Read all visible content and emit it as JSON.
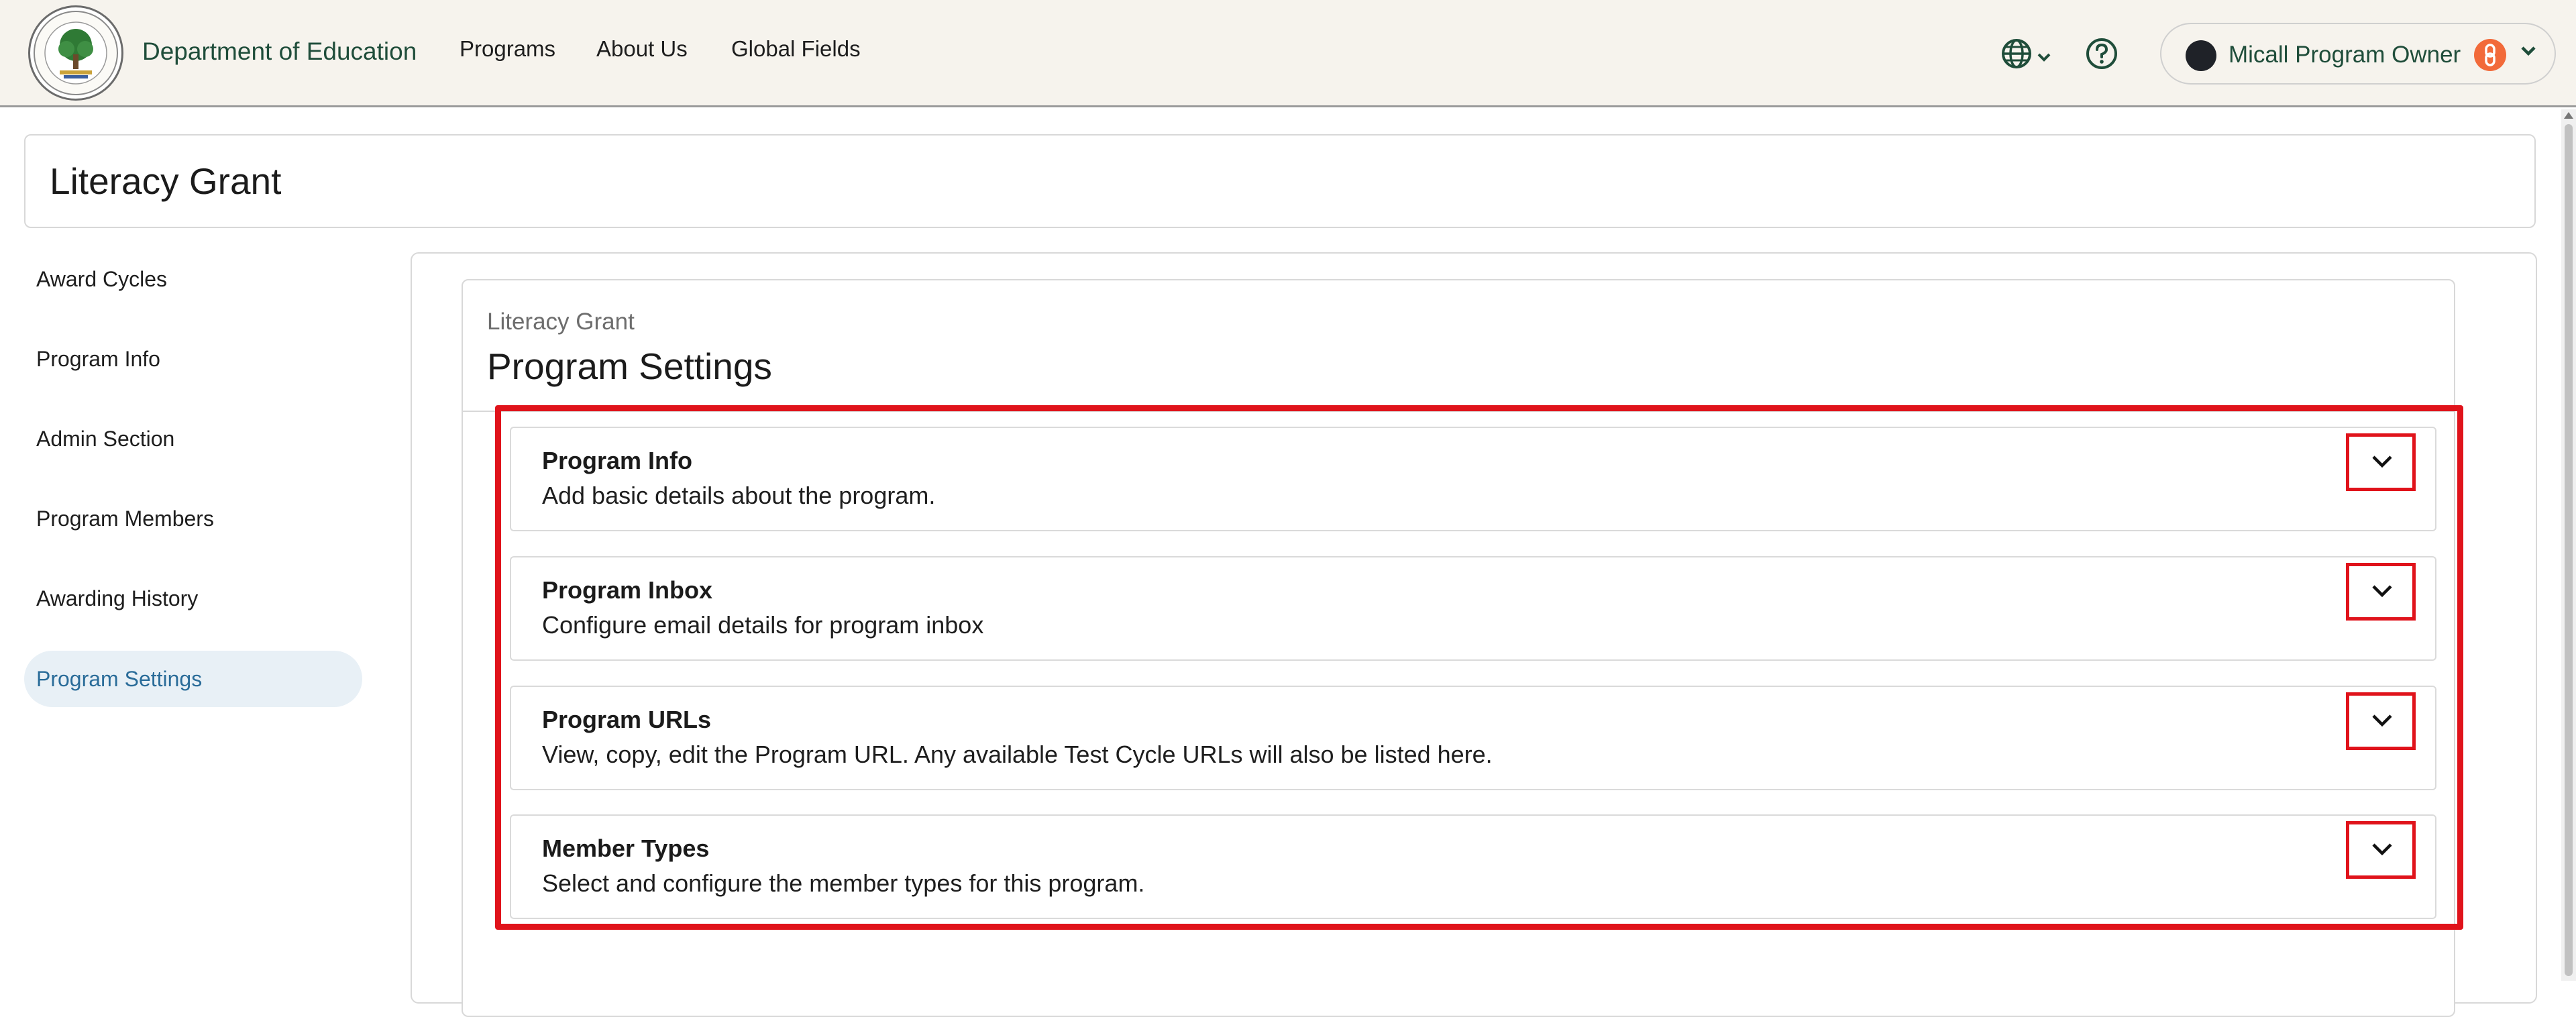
{
  "header": {
    "brand": "Department of Education",
    "nav": [
      "Programs",
      "About Us",
      "Global Fields"
    ],
    "icons": [
      "globe-icon",
      "chevron-down-icon",
      "help-circle-icon"
    ],
    "user": {
      "name": "Micall Program Owner",
      "badge_icon": "link-icon"
    }
  },
  "page": {
    "title": "Literacy Grant"
  },
  "sidebar": {
    "items": [
      {
        "label": "Award Cycles",
        "active": false
      },
      {
        "label": "Program Info",
        "active": false
      },
      {
        "label": "Admin Section",
        "active": false
      },
      {
        "label": "Program Members",
        "active": false
      },
      {
        "label": "Awarding History",
        "active": false
      },
      {
        "label": "Program Settings",
        "active": true
      }
    ]
  },
  "main": {
    "breadcrumb": "Literacy Grant",
    "title": "Program Settings",
    "sections": [
      {
        "title": "Program Info",
        "description": "Add basic details about the program."
      },
      {
        "title": "Program Inbox",
        "description": "Configure email details for program inbox"
      },
      {
        "title": "Program URLs",
        "description": "View, copy, edit the Program URL. Any available Test Cycle URLs will also be listed here."
      },
      {
        "title": "Member Types",
        "description": "Select and configure the member types for this program."
      }
    ]
  },
  "colors": {
    "header_bg": "#f6f3ed",
    "brand_green": "#1f4d3a",
    "active_bg": "#e8f0f6",
    "active_text": "#2a6c99",
    "highlight_red": "#e0131b",
    "badge_orange": "#f26a3a"
  }
}
